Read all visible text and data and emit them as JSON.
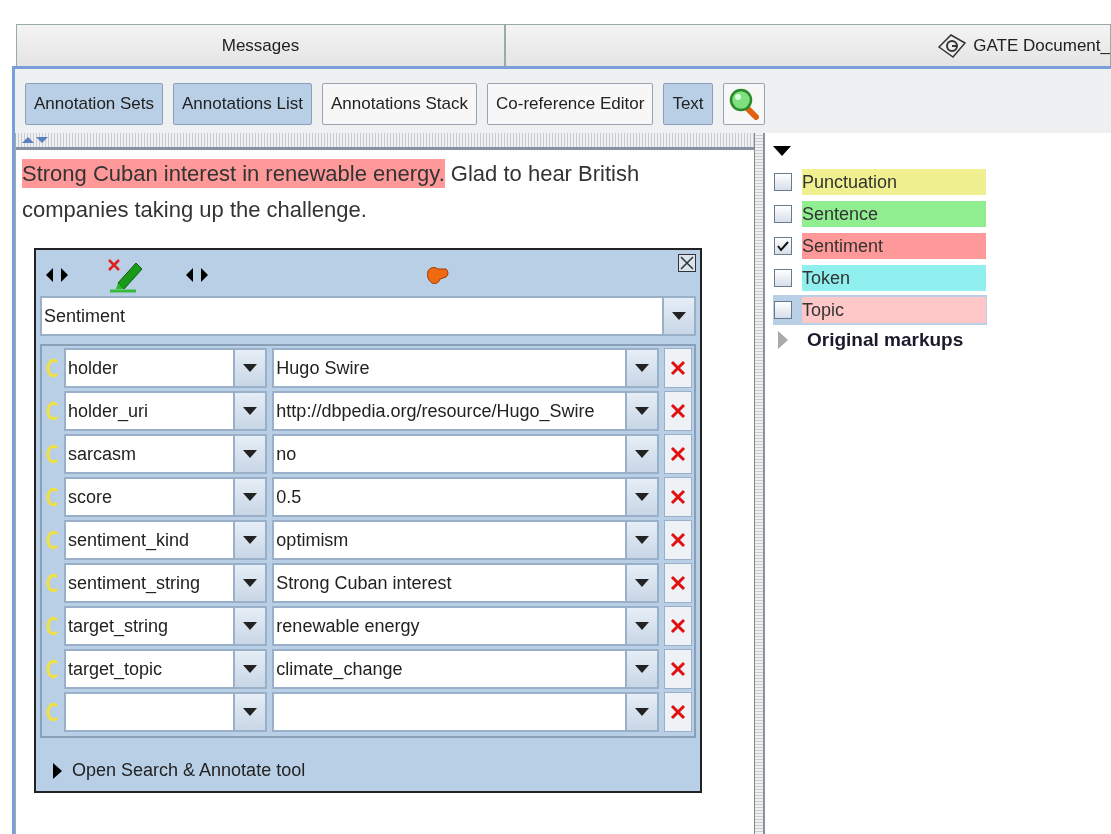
{
  "tabs": [
    {
      "label": "Messages",
      "icon": false
    },
    {
      "label": "GATE Document_",
      "icon": true
    }
  ],
  "toolbar": {
    "buttons": [
      {
        "label": "Annotation Sets",
        "selected": true
      },
      {
        "label": "Annotations List",
        "selected": true
      },
      {
        "label": "Annotations Stack",
        "selected": false
      },
      {
        "label": "Co-reference Editor",
        "selected": false
      },
      {
        "label": "Text",
        "selected": true
      }
    ]
  },
  "document": {
    "segments": [
      {
        "text": "Strong Cuban interest in renewable energy.",
        "color": "#ff9999"
      },
      {
        "text": " Glad to hear British companies taking up the challenge."
      }
    ]
  },
  "annotation_editor": {
    "type": "Sentiment",
    "features": [
      {
        "kind": "feature",
        "name": "holder",
        "value": "Hugo Swire"
      },
      {
        "kind": "feature",
        "name": "holder_uri",
        "value": "http://dbpedia.org/resource/Hugo_Swire"
      },
      {
        "kind": "feature",
        "name": "sarcasm",
        "value": "no"
      },
      {
        "kind": "feature",
        "name": "score",
        "value": "0.5"
      },
      {
        "kind": "feature",
        "name": "sentiment_kind",
        "value": "optimism"
      },
      {
        "kind": "feature",
        "name": "sentiment_string",
        "value": "Strong Cuban interest"
      },
      {
        "kind": "feature",
        "name": "target_string",
        "value": "renewable energy"
      },
      {
        "kind": "feature",
        "name": "target_topic",
        "value": "climate_change"
      },
      {
        "kind": "new"
      }
    ],
    "search_tool": {
      "label": "Open Search & Annotate tool",
      "expanded": false
    }
  },
  "annotation_sets": {
    "default_set": {
      "expanded": true,
      "types": [
        {
          "label": "Punctuation",
          "color": "#f0f090",
          "checked": false,
          "selected": false
        },
        {
          "label": "Sentence",
          "color": "#90ee90",
          "checked": false,
          "selected": false
        },
        {
          "label": "Sentiment",
          "color": "#ff9999",
          "checked": true,
          "selected": false
        },
        {
          "label": "Token",
          "color": "#90f0f0",
          "checked": false,
          "selected": false
        },
        {
          "label": "Topic",
          "color": "#ffc8c8",
          "checked": false,
          "selected": true
        }
      ]
    },
    "other_sets": [
      {
        "label": "Original markups",
        "expanded": false
      }
    ]
  }
}
